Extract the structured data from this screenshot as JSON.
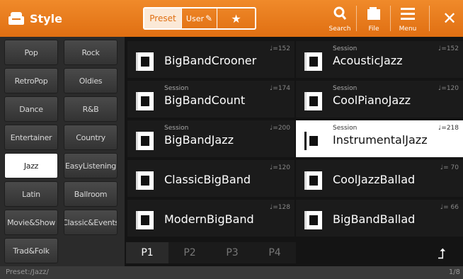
{
  "header": {
    "title": "Style",
    "tabs": {
      "preset": "Preset",
      "user": "User",
      "favorite": "★"
    },
    "buttons": {
      "search": "Search",
      "file": "File",
      "menu": "Menu",
      "close": "✕"
    }
  },
  "categories": [
    {
      "label": "Pop"
    },
    {
      "label": "Rock"
    },
    {
      "label": "RetroPop"
    },
    {
      "label": "Oldies"
    },
    {
      "label": "Dance"
    },
    {
      "label": "R&B"
    },
    {
      "label": "Entertainer"
    },
    {
      "label": "Country"
    },
    {
      "label": "Jazz",
      "selected": true
    },
    {
      "label": "EasyListening"
    },
    {
      "label": "Latin"
    },
    {
      "label": "Ballroom"
    },
    {
      "label": "Movie&Show"
    },
    {
      "label": "Classic&Events"
    },
    {
      "label": "Trad&Folk"
    }
  ],
  "styles": [
    {
      "name": "BigBandCrooner",
      "tag": "",
      "tempo": "♩=152"
    },
    {
      "name": "AcousticJazz",
      "tag": "Session",
      "tempo": "♩=152"
    },
    {
      "name": "BigBandCount",
      "tag": "Session",
      "tempo": "♩=174"
    },
    {
      "name": "CoolPianoJazz",
      "tag": "Session",
      "tempo": "♩=120"
    },
    {
      "name": "BigBandJazz",
      "tag": "Session",
      "tempo": "♩=200"
    },
    {
      "name": "InstrumentalJazz",
      "tag": "Session",
      "tempo": "♩=218",
      "selected": true
    },
    {
      "name": "ClassicBigBand",
      "tag": "",
      "tempo": "♩=120"
    },
    {
      "name": "CoolJazzBallad",
      "tag": "",
      "tempo": "♩= 70"
    },
    {
      "name": "ModernBigBand",
      "tag": "",
      "tempo": "♩=128"
    },
    {
      "name": "BigBandBallad",
      "tag": "",
      "tempo": "♩= 66"
    }
  ],
  "pages": [
    "P1",
    "P2",
    "P3",
    "P4"
  ],
  "up_button": "⮥",
  "status": {
    "path": "Preset:/Jazz/",
    "page": "1/8"
  },
  "colors": {
    "accent": "#e57a1c",
    "selected_bg": "#ffffff"
  }
}
